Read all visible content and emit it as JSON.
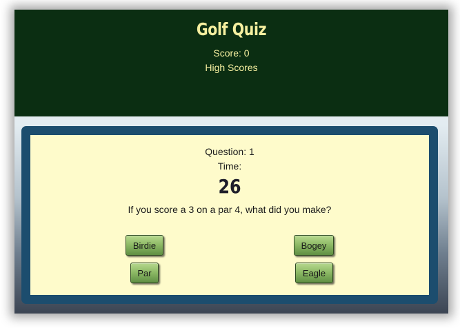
{
  "header": {
    "title": "Golf Quiz",
    "score_text": "Score: 0",
    "high_scores_label": "High Scores"
  },
  "quiz": {
    "question_number_text": "Question: 1",
    "time_label": "Time:",
    "timer_value": "26",
    "question_text": "If you score a 3 on a par 4, what did you make?",
    "answers": [
      {
        "label": "Birdie"
      },
      {
        "label": "Bogey"
      },
      {
        "label": "Par"
      },
      {
        "label": "Eagle"
      }
    ]
  },
  "colors": {
    "header_bg": "#0b2e12",
    "header_text": "#f6f0a0",
    "frame_bg": "#1c4d6e",
    "panel_bg": "#fefbcb",
    "button_green": "#8fbb67"
  }
}
